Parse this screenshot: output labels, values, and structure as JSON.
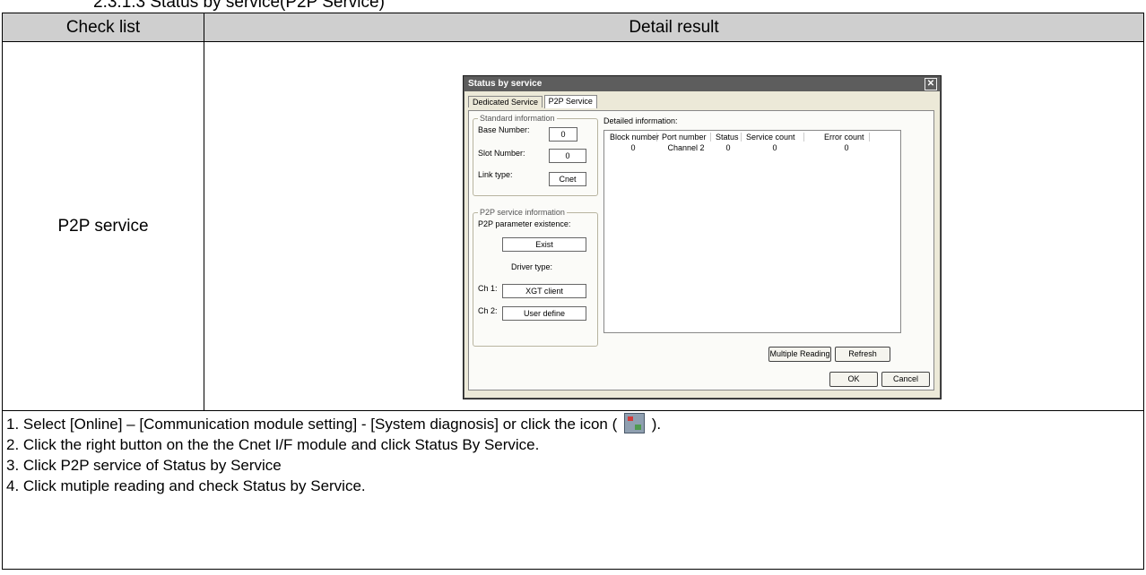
{
  "heading": "2.3.1.3 Status by service(P2P Service)",
  "table": {
    "col_check": "Check list",
    "col_result": "Detail result",
    "item": "P2P service"
  },
  "dialog": {
    "title": "Status by service",
    "close": "✕",
    "tabs": [
      "Dedicated Service",
      "P2P Service"
    ],
    "standard": {
      "group": "Standard information",
      "base_label": "Base Number:",
      "base_value": "0",
      "slot_label": "Slot Number:",
      "slot_value": "0",
      "link_label": "Link type:",
      "link_value": "Cnet"
    },
    "p2p": {
      "group": "P2P service information",
      "param_label": "P2P parameter existence:",
      "param_value": "Exist",
      "driver_label": "Driver type:",
      "ch1_label": "Ch 1:",
      "ch1_value": "XGT client",
      "ch2_label": "Ch 2:",
      "ch2_value": "User define"
    },
    "detail_label": "Detailed information:",
    "columns": [
      "Block number",
      "Port number",
      "Status",
      "Service count",
      "Error count"
    ],
    "row": [
      "0",
      "Channel 2",
      "0",
      "0",
      "0"
    ],
    "buttons": {
      "multiple": "Multiple Reading",
      "refresh": "Refresh",
      "ok": "OK",
      "cancel": "Cancel"
    }
  },
  "steps": {
    "s1a": "1. Select [Online] – [Communication module setting] - [System diagnosis] or click the icon (",
    "s1b": ").",
    "s2": "2. Click the right button on the the Cnet I/F module and click Status By Service.",
    "s3": "3. Click P2P service of Status by Service",
    "s4": "4. Click mutiple reading and check Status by Service."
  },
  "icon": "system-diagnosis-icon"
}
